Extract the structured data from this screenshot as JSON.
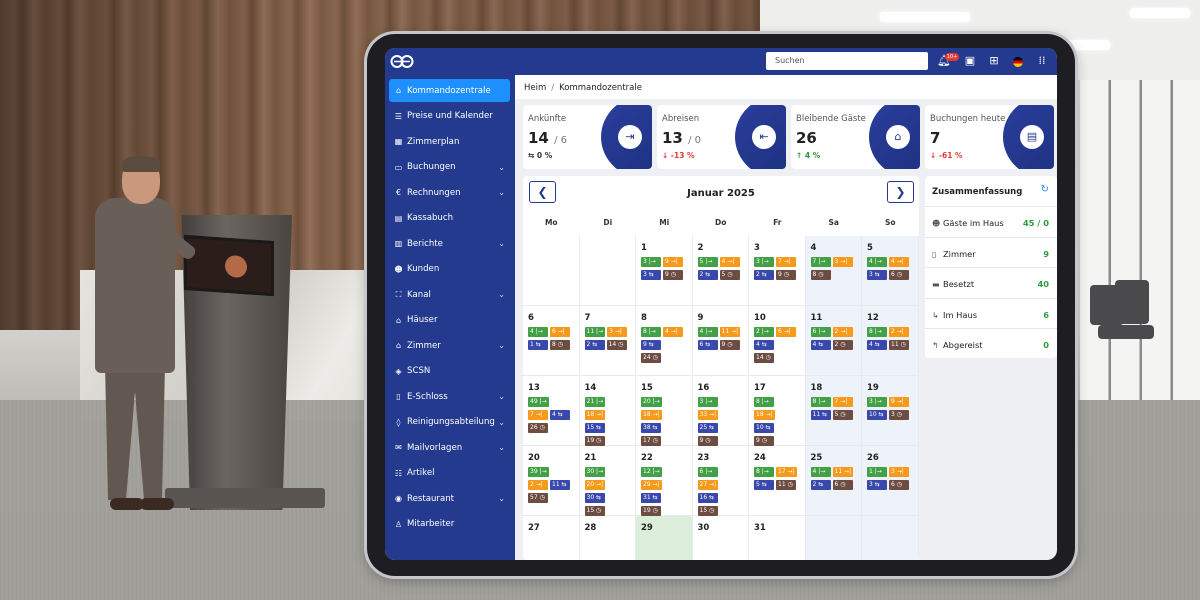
{
  "topbar": {
    "search_placeholder": "Suchen",
    "notif_count": "10+"
  },
  "sidebar": {
    "items": [
      {
        "label": "Kommandozentrale",
        "icon": "home-icon",
        "glyph": "⌂",
        "chev": false
      },
      {
        "label": "Preise und Kalender",
        "icon": "list-icon",
        "glyph": "☰",
        "chev": false
      },
      {
        "label": "Zimmerplan",
        "icon": "grid-icon",
        "glyph": "▦",
        "chev": false
      },
      {
        "label": "Buchungen",
        "icon": "monitor-icon",
        "glyph": "▭",
        "chev": true
      },
      {
        "label": "Rechnungen",
        "icon": "euro-icon",
        "glyph": "€",
        "chev": true
      },
      {
        "label": "Kassabuch",
        "icon": "book-icon",
        "glyph": "▤",
        "chev": false
      },
      {
        "label": "Berichte",
        "icon": "report-icon",
        "glyph": "▥",
        "chev": true
      },
      {
        "label": "Kunden",
        "icon": "users-icon",
        "glyph": "☻",
        "chev": false
      },
      {
        "label": "Kanal",
        "icon": "channel-icon",
        "glyph": "⛶",
        "chev": true
      },
      {
        "label": "Häuser",
        "icon": "house-icon",
        "glyph": "⌂",
        "chev": false
      },
      {
        "label": "Zimmer",
        "icon": "room-icon",
        "glyph": "⌂",
        "chev": true
      },
      {
        "label": "SCSN",
        "icon": "cube-icon",
        "glyph": "◈",
        "chev": false
      },
      {
        "label": "E-Schloss",
        "icon": "lock-icon",
        "glyph": "▯",
        "chev": true
      },
      {
        "label": "Reinigungsabteilung",
        "icon": "drop-icon",
        "glyph": "◊",
        "chev": true
      },
      {
        "label": "Mailvorlagen",
        "icon": "mail-icon",
        "glyph": "✉",
        "chev": true
      },
      {
        "label": "Artikel",
        "icon": "tag-icon",
        "glyph": "☷",
        "chev": false
      },
      {
        "label": "Restaurant",
        "icon": "restaurant-icon",
        "glyph": "◉",
        "chev": true
      },
      {
        "label": "Mitarbeiter",
        "icon": "user-icon",
        "glyph": "♙",
        "chev": false
      }
    ]
  },
  "breadcrumb": {
    "home": "Heim",
    "current": "Kommandozentrale"
  },
  "stats": [
    {
      "label": "Ankünfte",
      "value": "14",
      "total": "/ 6",
      "change": "⇆ 0 %",
      "color": "#333",
      "glyph": "⇥",
      "icon": "door-in-icon"
    },
    {
      "label": "Abreisen",
      "value": "13",
      "total": "/ 0",
      "change": "↓ -13 %",
      "color": "#e53935",
      "glyph": "⇤",
      "icon": "door-out-icon"
    },
    {
      "label": "Bleibende Gäste",
      "value": "26",
      "total": "",
      "change": "↑ 4 %",
      "color": "#2e9c3a",
      "glyph": "⌂",
      "icon": "house-heart-icon"
    },
    {
      "label": "Buchungen heute",
      "value": "7",
      "total": "",
      "change": "↓ -61 %",
      "color": "#e53935",
      "glyph": "▤",
      "icon": "clipboard-icon"
    }
  ],
  "calendar": {
    "month": "Januar 2025",
    "dows": [
      "Mo",
      "Di",
      "Mi",
      "Do",
      "Fr",
      "Sa",
      "So"
    ],
    "weeks": [
      [
        null,
        null,
        {
          "d": "1",
          "r": [
            [
              [
                "g",
                "3 |→"
              ],
              [
                "o",
                "9 →|"
              ]
            ],
            [
              [
                "u",
                "3 ⇆"
              ],
              [
                "n",
                "9 ◷"
              ]
            ]
          ]
        },
        {
          "d": "2",
          "r": [
            [
              [
                "g",
                "5 |→"
              ],
              [
                "o",
                "4 →|"
              ]
            ],
            [
              [
                "u",
                "2 ⇆"
              ],
              [
                "n",
                "5 ◷"
              ]
            ]
          ]
        },
        {
          "d": "3",
          "r": [
            [
              [
                "g",
                "3 |→"
              ],
              [
                "o",
                "7 →|"
              ]
            ],
            [
              [
                "u",
                "2 ⇆"
              ],
              [
                "n",
                "9 ◷"
              ]
            ]
          ]
        },
        {
          "d": "4",
          "r": [
            [
              [
                "g",
                "7 |→"
              ],
              [
                "o",
                "3 →|"
              ]
            ],
            [
              [
                "n",
                "8 ◷"
              ]
            ]
          ]
        },
        {
          "d": "5",
          "r": [
            [
              [
                "g",
                "4 |→"
              ],
              [
                "o",
                "4 →|"
              ]
            ],
            [
              [
                "u",
                "3 ⇆"
              ],
              [
                "n",
                "6 ◷"
              ]
            ]
          ]
        }
      ],
      [
        {
          "d": "6",
          "r": [
            [
              [
                "g",
                "4 |→"
              ],
              [
                "o",
                "6 →|"
              ]
            ],
            [
              [
                "u",
                "1 ⇆"
              ],
              [
                "n",
                "8 ◷"
              ]
            ]
          ]
        },
        {
          "d": "7",
          "r": [
            [
              [
                "g",
                "11 |→"
              ],
              [
                "o",
                "3 →|"
              ]
            ],
            [
              [
                "u",
                "2 ⇆"
              ],
              [
                "n",
                "14 ◷"
              ]
            ]
          ]
        },
        {
          "d": "8",
          "r": [
            [
              [
                "g",
                "8 |→"
              ],
              [
                "o",
                "4 →|"
              ]
            ],
            [
              [
                "u",
                "9 ⇆"
              ]
            ],
            [
              [
                "n",
                "24 ◷"
              ]
            ]
          ]
        },
        {
          "d": "9",
          "r": [
            [
              [
                "g",
                "4 |→"
              ],
              [
                "o",
                "11 →|"
              ]
            ],
            [
              [
                "u",
                "6 ⇆"
              ],
              [
                "n",
                "9 ◷"
              ]
            ]
          ]
        },
        {
          "d": "10",
          "r": [
            [
              [
                "g",
                "2 |→"
              ],
              [
                "o",
                "6 →|"
              ]
            ],
            [
              [
                "u",
                "4 ⇆"
              ]
            ],
            [
              [
                "n",
                "14 ◷"
              ]
            ]
          ]
        },
        {
          "d": "11",
          "r": [
            [
              [
                "g",
                "6 |→"
              ],
              [
                "o",
                "2 →|"
              ]
            ],
            [
              [
                "u",
                "4 ⇆"
              ],
              [
                "n",
                "2 ◷"
              ]
            ]
          ]
        },
        {
          "d": "12",
          "r": [
            [
              [
                "g",
                "8 |→"
              ],
              [
                "o",
                "2 →|"
              ]
            ],
            [
              [
                "u",
                "4 ⇆"
              ],
              [
                "n",
                "11 ◷"
              ]
            ]
          ]
        }
      ],
      [
        {
          "d": "13",
          "r": [
            [
              [
                "g",
                "49 |→"
              ]
            ],
            [
              [
                "o",
                "7 →|"
              ],
              [
                "u",
                "4 ⇆"
              ]
            ],
            [
              [
                "n",
                "26 ◷"
              ]
            ]
          ]
        },
        {
          "d": "14",
          "r": [
            [
              [
                "g",
                "21 |→"
              ]
            ],
            [
              [
                "o",
                "18 →|"
              ]
            ],
            [
              [
                "u",
                "15 ⇆"
              ]
            ],
            [
              [
                "n",
                "19 ◷"
              ]
            ]
          ]
        },
        {
          "d": "15",
          "r": [
            [
              [
                "g",
                "20 |→"
              ]
            ],
            [
              [
                "o",
                "18 →|"
              ]
            ],
            [
              [
                "u",
                "38 ⇆"
              ]
            ],
            [
              [
                "n",
                "17 ◷"
              ]
            ]
          ]
        },
        {
          "d": "16",
          "r": [
            [
              [
                "g",
                "3 |→"
              ]
            ],
            [
              [
                "o",
                "33 →|"
              ]
            ],
            [
              [
                "u",
                "25 ⇆"
              ]
            ],
            [
              [
                "n",
                "9 ◷"
              ]
            ]
          ]
        },
        {
          "d": "17",
          "r": [
            [
              [
                "g",
                "8 |→"
              ]
            ],
            [
              [
                "o",
                "18 →|"
              ]
            ],
            [
              [
                "u",
                "10 ⇆"
              ]
            ],
            [
              [
                "n",
                "9 ◷"
              ]
            ]
          ]
        },
        {
          "d": "18",
          "r": [
            [
              [
                "g",
                "8 |→"
              ],
              [
                "o",
                "7 →|"
              ]
            ],
            [
              [
                "u",
                "11 ⇆"
              ],
              [
                "n",
                "5 ◷"
              ]
            ]
          ]
        },
        {
          "d": "19",
          "r": [
            [
              [
                "g",
                "3 |→"
              ],
              [
                "o",
                "9 →|"
              ]
            ],
            [
              [
                "u",
                "10 ⇆"
              ],
              [
                "n",
                "3 ◷"
              ]
            ]
          ]
        }
      ],
      [
        {
          "d": "20",
          "r": [
            [
              [
                "g",
                "39 |→"
              ]
            ],
            [
              [
                "o",
                "2 →|"
              ],
              [
                "u",
                "11 ⇆"
              ]
            ],
            [
              [
                "n",
                "57 ◷"
              ]
            ]
          ]
        },
        {
          "d": "21",
          "r": [
            [
              [
                "g",
                "30 |→"
              ]
            ],
            [
              [
                "o",
                "20 →|"
              ]
            ],
            [
              [
                "u",
                "30 ⇆"
              ]
            ],
            [
              [
                "n",
                "15 ◷"
              ]
            ]
          ]
        },
        {
          "d": "22",
          "r": [
            [
              [
                "g",
                "12 |→"
              ]
            ],
            [
              [
                "o",
                "29 →|"
              ]
            ],
            [
              [
                "u",
                "31 ⇆"
              ]
            ],
            [
              [
                "n",
                "19 ◷"
              ]
            ]
          ]
        },
        {
          "d": "23",
          "r": [
            [
              [
                "g",
                "6 |→"
              ]
            ],
            [
              [
                "o",
                "27 →|"
              ]
            ],
            [
              [
                "u",
                "16 ⇆"
              ]
            ],
            [
              [
                "n",
                "15 ◷"
              ]
            ]
          ]
        },
        {
          "d": "24",
          "r": [
            [
              [
                "g",
                "8 |→"
              ],
              [
                "o",
                "17 →|"
              ]
            ],
            [
              [
                "u",
                "5 ⇆"
              ],
              [
                "n",
                "11 ◷"
              ]
            ]
          ]
        },
        {
          "d": "25",
          "r": [
            [
              [
                "g",
                "4 |→"
              ],
              [
                "o",
                "11 →|"
              ]
            ],
            [
              [
                "u",
                "2 ⇆"
              ],
              [
                "n",
                "6 ◷"
              ]
            ]
          ]
        },
        {
          "d": "26",
          "r": [
            [
              [
                "g",
                "1 |→"
              ],
              [
                "o",
                "3 →|"
              ]
            ],
            [
              [
                "u",
                "3 ⇆"
              ],
              [
                "n",
                "6 ◷"
              ]
            ]
          ]
        }
      ],
      [
        {
          "d": "27",
          "r": []
        },
        {
          "d": "28",
          "r": []
        },
        {
          "d": "29",
          "r": [],
          "today": true
        },
        {
          "d": "30",
          "r": []
        },
        {
          "d": "31",
          "r": []
        },
        null,
        null
      ]
    ]
  },
  "summary": {
    "title": "Zusammenfassung",
    "rows": [
      {
        "label": "Gäste im Haus",
        "value": "45 / 0",
        "glyph": "☻",
        "icon": "guests-icon"
      },
      {
        "label": "Zimmer",
        "value": "9",
        "glyph": "▯",
        "icon": "door-icon"
      },
      {
        "label": "Besetzt",
        "value": "40",
        "glyph": "▬",
        "icon": "bed-icon"
      },
      {
        "label": "Im Haus",
        "value": "6",
        "glyph": "↳",
        "icon": "in-house-icon"
      },
      {
        "label": "Abgereist",
        "value": "0",
        "glyph": "↰",
        "icon": "departed-icon"
      }
    ]
  },
  "colors": {
    "brand": "#243a8e",
    "active": "#1e8fff",
    "arrival": "#43a047",
    "departure": "#f59a1b",
    "stay": "#3949ab",
    "pending": "#6d4c41"
  }
}
